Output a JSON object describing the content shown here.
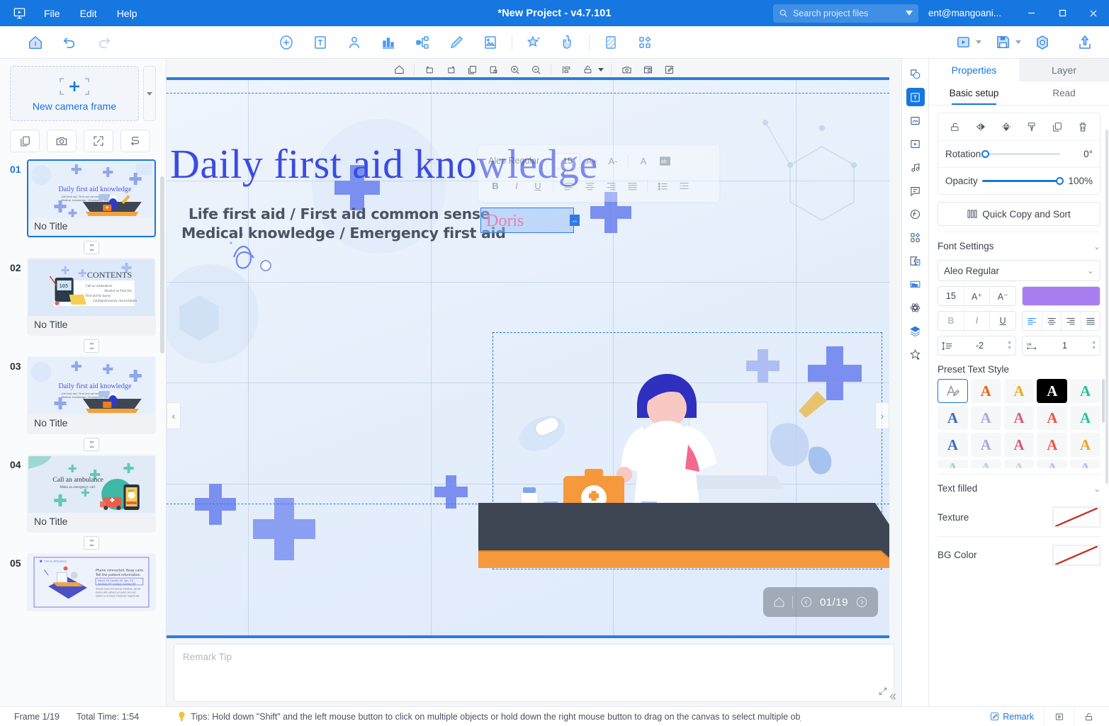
{
  "titlebar": {
    "app_icon": "presentation-logo-icon",
    "menus": [
      "File",
      "Edit",
      "Help"
    ],
    "title": "*New Project - v4.7.101",
    "search_placeholder": "Search project files",
    "account": "ent@mangoani...",
    "window_buttons": [
      "minimize",
      "maximize",
      "close"
    ]
  },
  "toolbar": {
    "left": [
      {
        "name": "home-icon",
        "label": "Home"
      },
      {
        "name": "undo-icon",
        "label": "Undo"
      },
      {
        "name": "redo-icon",
        "label": "Redo"
      }
    ],
    "center": [
      {
        "name": "add-icon",
        "label": "Add"
      },
      {
        "name": "text-icon",
        "label": "Text"
      },
      {
        "name": "character-icon",
        "label": "Character"
      },
      {
        "name": "chart-icon",
        "label": "Chart"
      },
      {
        "name": "mindmap-icon",
        "label": "Mind map"
      },
      {
        "name": "pen-icon",
        "label": "Pen"
      },
      {
        "name": "image-icon",
        "label": "Image"
      },
      {
        "name": "effect-icon",
        "label": "Effects"
      },
      {
        "name": "hand-icon",
        "label": "Interaction"
      },
      {
        "name": "background-icon",
        "label": "Background"
      },
      {
        "name": "components-icon",
        "label": "Components"
      }
    ],
    "right": [
      {
        "name": "play-icon",
        "label": "Preview"
      },
      {
        "name": "save-icon",
        "label": "Save"
      },
      {
        "name": "settings-icon",
        "label": "Settings"
      },
      {
        "name": "export-icon",
        "label": "Export"
      }
    ]
  },
  "left_panel": {
    "camera_frame_label": "New camera frame",
    "action_buttons": [
      {
        "name": "copy-frame-icon"
      },
      {
        "name": "camera-icon"
      },
      {
        "name": "fit-icon"
      },
      {
        "name": "path-icon"
      }
    ],
    "slides": [
      {
        "num": "01",
        "title": "No Title",
        "kind": "cover",
        "active": true
      },
      {
        "num": "02",
        "title": "No Title",
        "kind": "contents",
        "active": false
      },
      {
        "num": "03",
        "title": "No Title",
        "kind": "cover",
        "active": false
      },
      {
        "num": "04",
        "title": "No Title",
        "kind": "ambulance",
        "active": false
      },
      {
        "num": "05",
        "title": "",
        "kind": "phone",
        "active": false
      }
    ],
    "thumb_texts": {
      "cover_title": "Daily first aid knowledge",
      "cover_sub1": "Life first aid / First aid common sense",
      "cover_sub2": "Medical knowledge / Emergency first aid",
      "contents_title": "CONTENTS",
      "contents_items": [
        "Call an ambulance",
        "Alcohol on First Aid",
        "First aid for burns",
        "Cardiopulmonary resuscitation"
      ],
      "amb_title": "Call an ambulance",
      "amb_sub": "Make an emergency call",
      "phone_tag": "Call an ambulance",
      "phone_title": "Phone connected, Keep calm.",
      "phone_title2": "Tell the patient information",
      "phone_line1": "Name:XX    Gender:XX    Age: XX",
      "phone_line2": "Address:XX contact number:XX",
      "phone_body": "Should have self-saving initiative, participation with advanced event and put efforts to achieve moderate magnitude."
    }
  },
  "canvas_toolbar": [
    {
      "name": "home-icon"
    },
    {
      "name": "rotate-left-icon"
    },
    {
      "name": "rotate-right-icon"
    },
    {
      "name": "copy-icon"
    },
    {
      "name": "paste-icon"
    },
    {
      "name": "zoom-in-icon"
    },
    {
      "name": "zoom-out-icon"
    },
    {
      "name": "align-icon"
    },
    {
      "name": "lock-icon"
    },
    {
      "name": "snapshot-icon"
    },
    {
      "name": "timeline-icon"
    },
    {
      "name": "edit-icon"
    }
  ],
  "stage": {
    "big_title": "Daily first aid knowledge",
    "subtitle_1": "Life first aid /  First aid common sense",
    "subtitle_2": "Medical knowledge /  Emergency first aid",
    "selected_text": "Doris",
    "page_indicator": "01/19",
    "prev_arrow": "‹",
    "next_arrow": "›",
    "floating_toolbar": {
      "font": "Aleo Regular",
      "size": "15",
      "buttons": [
        "A+",
        "A-",
        "A",
        "ab"
      ],
      "row2": [
        "B",
        "I",
        "U",
        "align-left",
        "align-center",
        "align-right",
        "align-justify",
        "list-bullet",
        "list-indent"
      ]
    }
  },
  "remark": {
    "placeholder": "Remark Tip",
    "expand_icon": "expand-icon"
  },
  "rail": [
    {
      "name": "shape-icon",
      "active": false
    },
    {
      "name": "text-box-icon",
      "active": true
    },
    {
      "name": "image-icon",
      "active": false
    },
    {
      "name": "video-icon",
      "active": false
    },
    {
      "name": "music-icon",
      "active": false
    },
    {
      "name": "subtitle-icon",
      "active": false
    },
    {
      "name": "formula-icon",
      "active": false
    },
    {
      "name": "components-icon",
      "active": false
    },
    {
      "name": "form-icon",
      "active": false
    },
    {
      "name": "button-icon",
      "active": false
    },
    {
      "name": "particle-icon",
      "active": false
    },
    {
      "name": "layers-icon",
      "active": false
    },
    {
      "name": "favorites-icon",
      "active": false
    }
  ],
  "right_panel": {
    "tabs": [
      {
        "label": "Properties",
        "active": true
      },
      {
        "label": "Layer",
        "active": false
      }
    ],
    "subtabs": [
      {
        "label": "Basic setup",
        "active": true
      },
      {
        "label": "Read",
        "active": false
      }
    ],
    "object_icons": [
      {
        "name": "unlock-icon"
      },
      {
        "name": "flip-horizontal-icon"
      },
      {
        "name": "flip-vertical-icon"
      },
      {
        "name": "format-painter-icon"
      },
      {
        "name": "duplicate-icon"
      },
      {
        "name": "delete-icon"
      }
    ],
    "rotation": {
      "label": "Rotation",
      "value": "0°",
      "percent": 0
    },
    "opacity": {
      "label": "Opacity",
      "value": "100%",
      "percent": 100
    },
    "quick_copy": {
      "label": "Quick Copy and Sort",
      "icon": "columns-icon"
    },
    "font_settings": {
      "section_label": "Font Settings",
      "font_family": "Aleo Regular",
      "font_size": "15",
      "increase_label": "A⁺",
      "decrease_label": "A⁻",
      "color": "#a87ef0",
      "bold": "B",
      "italic": "I",
      "underline": "U",
      "align_options": [
        "align-left",
        "align-center",
        "align-right",
        "align-justify"
      ],
      "align_selected": "align-left",
      "line_height": "-2",
      "letter_spacing": "1"
    },
    "preset_text_style": {
      "label": "Preset Text Style",
      "items": [
        {
          "color": "#8d98a5",
          "sel": true,
          "glyph": "A"
        },
        {
          "color": "#f4610c",
          "sel": false,
          "glyph": "A"
        },
        {
          "color": "#f0ab17",
          "sel": false,
          "glyph": "A"
        },
        {
          "color": "#ffffff",
          "sel": false,
          "glyph": "A",
          "bg": "#000000"
        },
        {
          "color": "#23c29a",
          "sel": false,
          "glyph": "A"
        },
        {
          "color": "#3a6fc4",
          "sel": false,
          "glyph": "A"
        },
        {
          "color": "#a7a9d8",
          "sel": false,
          "glyph": "A"
        },
        {
          "color": "#d9597a",
          "sel": false,
          "glyph": "A"
        },
        {
          "color": "#ef5443",
          "sel": false,
          "glyph": "A"
        },
        {
          "color": "#22c49c",
          "sel": false,
          "glyph": "A"
        },
        {
          "color": "#3a6fc4",
          "sel": false,
          "glyph": "A"
        },
        {
          "color": "#a7a9d8",
          "sel": false,
          "glyph": "A"
        },
        {
          "color": "#d9597a",
          "sel": false,
          "glyph": "A"
        },
        {
          "color": "#ef5443",
          "sel": false,
          "glyph": "A"
        },
        {
          "color": "#f0a31b",
          "sel": false,
          "glyph": "A"
        },
        {
          "color": "#9fd8c2",
          "sel": false,
          "glyph": "A"
        },
        {
          "color": "#c3cede",
          "sel": false,
          "glyph": "A"
        },
        {
          "color": "#cbd2dd",
          "sel": false,
          "glyph": "A"
        },
        {
          "color": "#b9c6e0",
          "sel": false,
          "glyph": "A"
        },
        {
          "color": "#b3c3e4",
          "sel": false,
          "glyph": "A"
        }
      ]
    },
    "text_filled": {
      "section_label": "Text filled",
      "texture_label": "Texture",
      "texture_value": "none",
      "bg_color_label": "BG Color",
      "bg_color_value": "none"
    }
  },
  "statusbar": {
    "frame": "Frame 1/19",
    "total_time": "Total Time: 1:54",
    "tip_icon": "bulb-icon",
    "tip": "Tips: Hold down \"Shift\" and the left mouse button to click on multiple objects or hold down the right mouse button to drag on the canvas to select multiple objects. Hold down \"Al",
    "remark_label": "Remark",
    "right_buttons": [
      {
        "name": "frame-view-icon"
      },
      {
        "name": "lock-canvas-icon"
      }
    ]
  },
  "colors": {
    "brand": "#1677e0",
    "title_text": "#3b4ce0",
    "accent_purple": "#a87ef0",
    "doris_pink": "#e87fb5"
  }
}
